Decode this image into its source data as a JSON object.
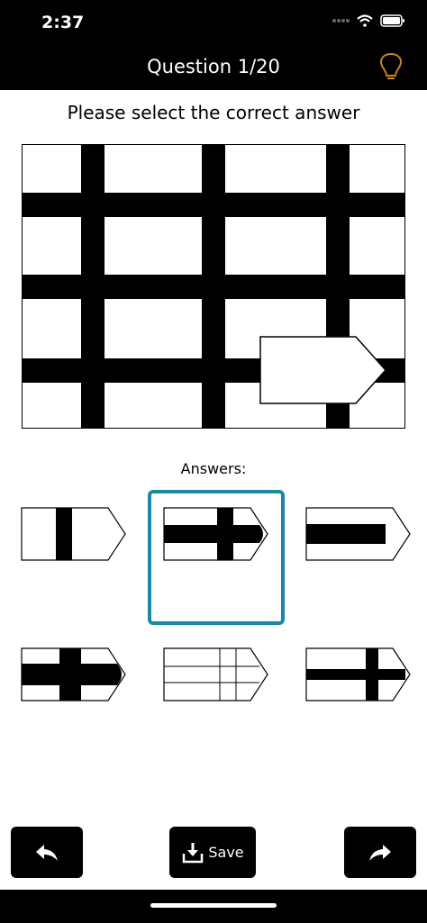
{
  "status_bar": {
    "time": "2:37"
  },
  "nav": {
    "title": "Question 1/20",
    "hint_icon": "lightbulb-icon"
  },
  "prompt": "Please select the correct answer",
  "answers_label": "Answers:",
  "answers": [
    {
      "name": "answer-option-1",
      "selected": false
    },
    {
      "name": "answer-option-2",
      "selected": true
    },
    {
      "name": "answer-option-3",
      "selected": false
    },
    {
      "name": "answer-option-4",
      "selected": false
    },
    {
      "name": "answer-option-5",
      "selected": false
    },
    {
      "name": "answer-option-6",
      "selected": false
    }
  ],
  "toolbar": {
    "back_icon": "reply-arrow-icon",
    "save_label": "Save",
    "save_icon": "download-tray-icon",
    "forward_icon": "forward-arrow-icon"
  },
  "colors": {
    "bars": "#000000",
    "background": "#ffffff",
    "selection": "#1b88a8",
    "hint_icon": "#c8841f"
  }
}
